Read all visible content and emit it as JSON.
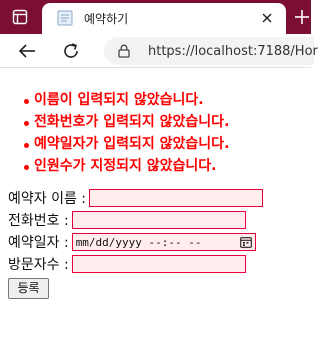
{
  "browser": {
    "tab": {
      "title": "예약하기",
      "close_symbol": "✕"
    },
    "new_tab_symbol": "+",
    "address": {
      "url": "https://localhost:7188/Hor"
    },
    "colors": {
      "tabbar": "#7a0f33",
      "tab": "#ffffff"
    }
  },
  "page": {
    "errors": [
      "이름이 입력되지 않았습니다.",
      "전화번호가 입력되지 않았습니다.",
      "예약일자가 입력되지 않았습니다.",
      "인원수가 지정되지 않았습니다."
    ],
    "form": {
      "name_label": "예약자 이름 :",
      "phone_label": "전화번호 :",
      "date_label": "예약일자 :",
      "date_placeholder": "mm/dd/yyyy  --:-- --",
      "visitors_label": "방문자수 :",
      "submit_label": "등록"
    },
    "colors": {
      "error_text": "#ff0000",
      "invalid_border": "#e5003c",
      "invalid_bg": "#ffecec"
    }
  }
}
